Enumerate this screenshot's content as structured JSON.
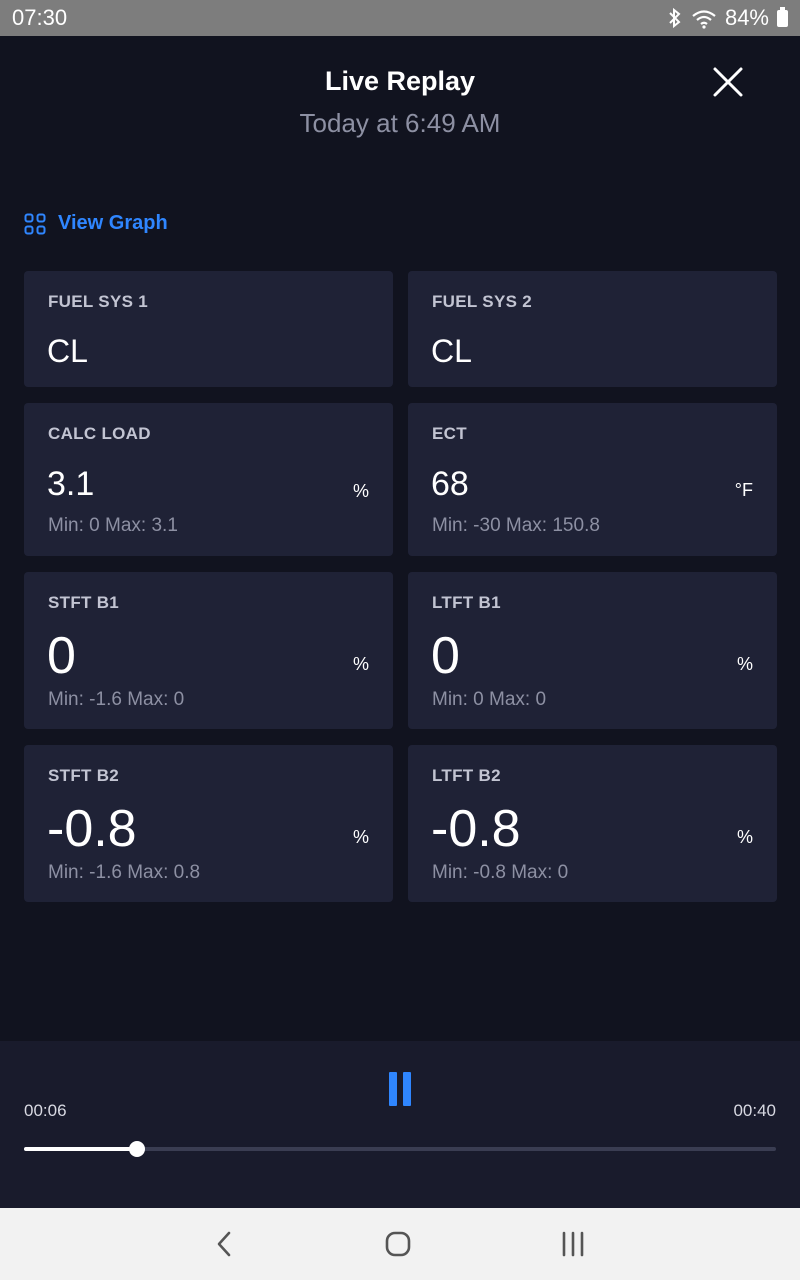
{
  "status_bar": {
    "time": "07:30",
    "battery": "84%"
  },
  "header": {
    "title": "Live Replay",
    "subtitle": "Today at 6:49 AM"
  },
  "view_graph_label": "View Graph",
  "cards": [
    {
      "label": "FUEL SYS 1",
      "value": "CL",
      "unit": "",
      "minmax": ""
    },
    {
      "label": "FUEL SYS 2",
      "value": "CL",
      "unit": "",
      "minmax": ""
    },
    {
      "label": "CALC LOAD",
      "value": "3.1",
      "unit": "%",
      "minmax": "Min: 0 Max: 3.1"
    },
    {
      "label": "ECT",
      "value": "68",
      "unit": "°F",
      "minmax": "Min: -30 Max: 150.8"
    },
    {
      "label": "STFT B1",
      "value": "0",
      "unit": "%",
      "minmax": "Min: -1.6 Max: 0"
    },
    {
      "label": "LTFT B1",
      "value": "0",
      "unit": "%",
      "minmax": "Min: 0 Max: 0"
    },
    {
      "label": "STFT B2",
      "value": "-0.8",
      "unit": "%",
      "minmax": "Min: -1.6 Max: 0.8"
    },
    {
      "label": "LTFT B2",
      "value": "-0.8",
      "unit": "%",
      "minmax": "Min: -0.8 Max: 0"
    }
  ],
  "player": {
    "elapsed": "00:06",
    "total": "00:40",
    "progress": 0.15
  },
  "colors": {
    "accent": "#2f86ff",
    "background": "#11131f",
    "card": "#1f2236"
  },
  "icons": {
    "close": "close-icon",
    "graph": "grid-icon",
    "pause": "pause-icon"
  }
}
